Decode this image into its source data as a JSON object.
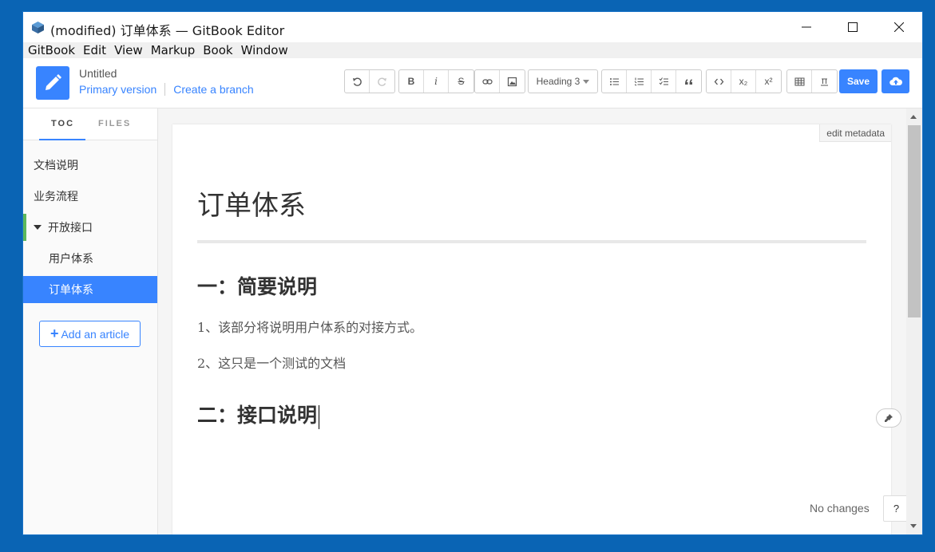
{
  "window": {
    "title": "(modified) 订单体系 — GitBook Editor"
  },
  "menu": [
    "GitBook",
    "Edit",
    "View",
    "Markup",
    "Book",
    "Window"
  ],
  "header": {
    "doc_title": "Untitled",
    "primary_version": "Primary version",
    "create_branch": "Create a branch",
    "heading_select": "Heading 3",
    "bold_label": "B",
    "italic_label": "i",
    "strike_label": "S",
    "subscript_label": "x₂",
    "superscript_label": "x²",
    "save_label": "Save",
    "accent_color": "#3884ff"
  },
  "sidebar": {
    "tabs": [
      "TOC",
      "FILES"
    ],
    "items": [
      {
        "label": "文档说明"
      },
      {
        "label": "业务流程"
      },
      {
        "label": "开放接口"
      },
      {
        "label": "用户体系"
      },
      {
        "label": "订单体系"
      }
    ],
    "add_article": "Add an article"
  },
  "editor": {
    "edit_metadata": "edit metadata",
    "h1": "订单体系",
    "section1_heading": "一：简要说明",
    "para1": "1、该部分将说明用户体系的对接方式。",
    "para2": "2、这只是一个测试的文档",
    "section2_heading": "二：接口说明",
    "status": "No changes",
    "help": "?"
  }
}
